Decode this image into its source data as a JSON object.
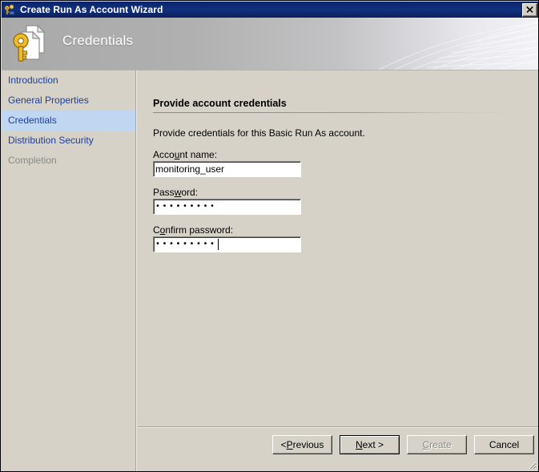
{
  "window": {
    "title": "Create Run As Account Wizard",
    "title_icon": "run-as-account-icon",
    "close_label": "X"
  },
  "banner": {
    "title": "Credentials",
    "icon": "key-document-icon"
  },
  "sidebar": {
    "items": [
      {
        "label": "Introduction",
        "state": "normal"
      },
      {
        "label": "General Properties",
        "state": "normal"
      },
      {
        "label": "Credentials",
        "state": "selected"
      },
      {
        "label": "Distribution Security",
        "state": "normal"
      },
      {
        "label": "Completion",
        "state": "disabled"
      }
    ],
    "selected_color": "#bfd7f0",
    "link_color": "#1d3f9e",
    "disabled_color": "#8a8a85"
  },
  "main": {
    "heading": "Provide account credentials",
    "intro": "Provide credentials for this Basic Run As account.",
    "fields": [
      {
        "label_before": "Acco",
        "label_accel": "u",
        "label_after": "nt name:",
        "label_full": "Account name:",
        "value": "monitoring_user",
        "masked": false,
        "focused": false
      },
      {
        "label_before": "Pass",
        "label_accel": "w",
        "label_after": "ord:",
        "label_full": "Password:",
        "value": "•••••••••",
        "masked": true,
        "mask_count": 9,
        "focused": false
      },
      {
        "label_before": "C",
        "label_accel": "o",
        "label_after": "nfirm password:",
        "label_full": "Confirm password:",
        "value": "•••••••••",
        "masked": true,
        "mask_count": 9,
        "focused": true
      }
    ]
  },
  "footer": {
    "buttons": [
      {
        "label": "< Previous",
        "before": "< ",
        "accel": "P",
        "after": "revious",
        "state": "normal"
      },
      {
        "label": "Next >",
        "before": "",
        "accel": "N",
        "after": "ext >",
        "state": "default"
      },
      {
        "label": "Create",
        "before": "",
        "accel": "C",
        "after": "reate",
        "state": "disabled"
      },
      {
        "label": "Cancel",
        "before": "",
        "accel": "",
        "after": "Cancel",
        "state": "normal"
      }
    ]
  },
  "colors": {
    "titlebar": "#0a246a",
    "face": "#d6d2c8",
    "field": "#ffffff",
    "key_gold": "#e8b830"
  }
}
